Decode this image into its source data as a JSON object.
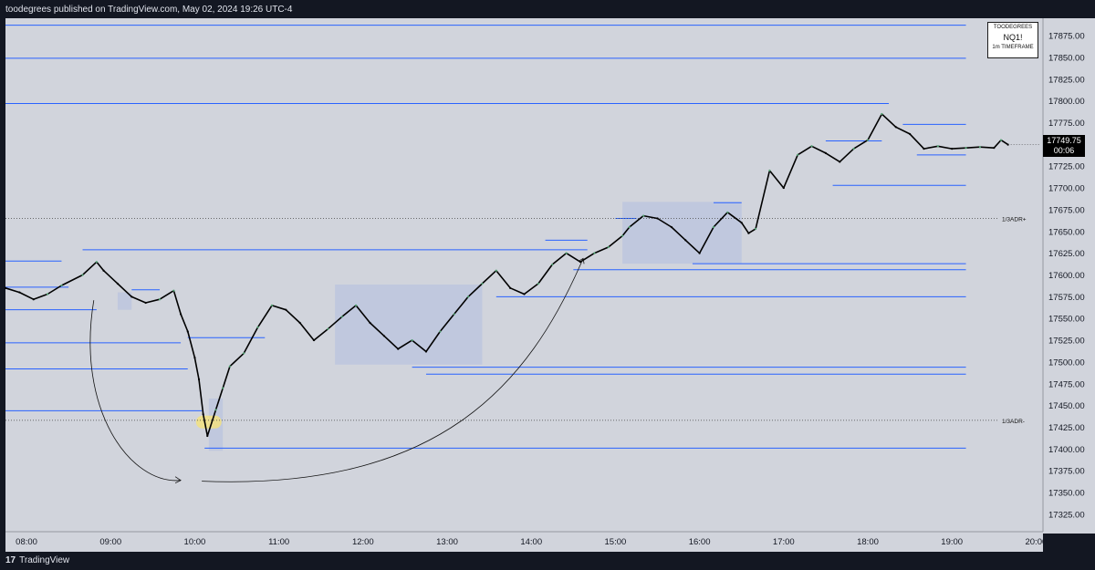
{
  "header": {
    "published": "toodegrees published on TradingView.com, May 02, 2024 19:26 UTC-4"
  },
  "footer": {
    "brand": "TradingView",
    "logo": "17"
  },
  "infobox": {
    "author": "TOODEGREES",
    "symbol": "NQ1!",
    "timeframe": "1m TIMEFRAME"
  },
  "price_tag": {
    "price": "17749.75",
    "countdown": "00:06"
  },
  "adr_labels": {
    "upper": "1/3ADR+",
    "lower": "1/3ADR-"
  },
  "colors": {
    "background": "#d1d4dc",
    "level_line": "#2962ff",
    "bull": "#50a070",
    "bear": "#000000",
    "zone": "#b2bee0",
    "highlight": "#f5e27a"
  },
  "chart_data": {
    "type": "line",
    "title": "",
    "xlabel": "",
    "ylabel": "",
    "x_ticks": [
      "08:00",
      "09:00",
      "10:00",
      "11:00",
      "12:00",
      "13:00",
      "14:00",
      "15:00",
      "16:00",
      "17:00",
      "18:00",
      "19:00",
      "20:00"
    ],
    "y_ticks": [
      17325,
      17350,
      17375,
      17400,
      17425,
      17450,
      17475,
      17500,
      17525,
      17550,
      17575,
      17600,
      17625,
      17650,
      17675,
      17700,
      17725,
      17750,
      17775,
      17800,
      17825,
      17850,
      17875
    ],
    "y_tick_labels": [
      "17325.00",
      "17350.00",
      "17375.00",
      "17400.00",
      "17425.00",
      "17450.00",
      "17475.00",
      "17500.00",
      "17525.00",
      "17550.00",
      "17575.00",
      "17600.00",
      "17625.00",
      "17650.00",
      "17675.00",
      "17700.00",
      "17725.00",
      "17750.00",
      "17775.00",
      "17800.00",
      "17825.00",
      "17850.00",
      "17875.00"
    ],
    "ylim": [
      17305,
      17895
    ],
    "xlim": [
      "07:45",
      "20:03"
    ],
    "series": [
      {
        "x": [
          "07:45",
          "07:55",
          "08:05",
          "08:15",
          "08:25",
          "08:40",
          "08:50",
          "08:55",
          "09:05",
          "09:15",
          "09:25",
          "09:35",
          "09:45",
          "09:50",
          "09:55",
          "10:00",
          "10:03",
          "10:06",
          "10:09",
          "10:15",
          "10:20",
          "10:25",
          "10:35",
          "10:45",
          "10:55",
          "11:05",
          "11:15",
          "11:25",
          "11:35",
          "11:45",
          "11:55",
          "12:05",
          "12:15",
          "12:25",
          "12:35",
          "12:45",
          "12:55",
          "13:05",
          "13:15",
          "13:25",
          "13:35",
          "13:45",
          "13:55",
          "14:05",
          "14:15",
          "14:25",
          "14:35",
          "14:45",
          "14:55",
          "15:05",
          "15:10",
          "15:20",
          "15:30",
          "15:40",
          "15:50",
          "16:00",
          "16:10",
          "16:20",
          "16:30",
          "16:35",
          "16:40",
          "16:50",
          "17:00",
          "17:10",
          "17:20",
          "17:30",
          "17:40",
          "17:50",
          "18:00",
          "18:10",
          "18:20",
          "18:30",
          "18:40",
          "18:50",
          "19:00",
          "19:10",
          "19:20",
          "19:30",
          "19:35",
          "19:40"
        ],
        "y": [
          17585,
          17580,
          17572,
          17578,
          17588,
          17600,
          17615,
          17605,
          17590,
          17575,
          17568,
          17572,
          17582,
          17555,
          17535,
          17505,
          17480,
          17440,
          17415,
          17445,
          17470,
          17495,
          17510,
          17540,
          17565,
          17560,
          17545,
          17525,
          17538,
          17552,
          17565,
          17545,
          17530,
          17515,
          17525,
          17512,
          17535,
          17555,
          17575,
          17590,
          17605,
          17585,
          17578,
          17590,
          17612,
          17625,
          17615,
          17625,
          17632,
          17645,
          17655,
          17668,
          17665,
          17655,
          17640,
          17625,
          17655,
          17672,
          17660,
          17648,
          17653,
          17720,
          17700,
          17738,
          17748,
          17740,
          17730,
          17745,
          17755,
          17785,
          17770,
          17762,
          17745,
          17748,
          17745,
          17746,
          17747,
          17746,
          17755,
          17749.75
        ]
      }
    ],
    "levels": [
      {
        "y": 17887,
        "from": "07:45",
        "to": "19:10"
      },
      {
        "y": 17849,
        "from": "07:45",
        "to": "19:10"
      },
      {
        "y": 17797,
        "from": "07:45",
        "to": "18:15"
      },
      {
        "y": 17773,
        "from": "18:25",
        "to": "19:10"
      },
      {
        "y": 17754,
        "from": "17:30",
        "to": "18:10"
      },
      {
        "y": 17738,
        "from": "18:35",
        "to": "19:10"
      },
      {
        "y": 17703,
        "from": "17:35",
        "to": "19:10"
      },
      {
        "y": 17683,
        "from": "16:10",
        "to": "16:30"
      },
      {
        "y": 17665,
        "from": "15:00",
        "to": "15:15"
      },
      {
        "y": 17640,
        "from": "14:10",
        "to": "14:40"
      },
      {
        "y": 17629,
        "from": "08:40",
        "to": "14:40"
      },
      {
        "y": 17616,
        "from": "07:45",
        "to": "08:25"
      },
      {
        "y": 17613,
        "from": "15:55",
        "to": "19:10"
      },
      {
        "y": 17606,
        "from": "14:30",
        "to": "19:10"
      },
      {
        "y": 17586,
        "from": "07:45",
        "to": "08:30"
      },
      {
        "y": 17583,
        "from": "09:15",
        "to": "09:35"
      },
      {
        "y": 17575,
        "from": "13:35",
        "to": "19:10"
      },
      {
        "y": 17560,
        "from": "07:45",
        "to": "08:50"
      },
      {
        "y": 17528,
        "from": "09:55",
        "to": "10:50"
      },
      {
        "y": 17522,
        "from": "07:45",
        "to": "09:50"
      },
      {
        "y": 17492,
        "from": "07:45",
        "to": "09:55"
      },
      {
        "y": 17494,
        "from": "12:35",
        "to": "19:10"
      },
      {
        "y": 17486,
        "from": "12:45",
        "to": "19:10"
      },
      {
        "y": 17444,
        "from": "07:45",
        "to": "10:05"
      },
      {
        "y": 17401,
        "from": "10:07",
        "to": "19:10"
      }
    ],
    "adr_levels": [
      {
        "label": "1/3ADR+",
        "y": 17665
      },
      {
        "label": "1/3ADR-",
        "y": 17433
      }
    ],
    "zones": [
      {
        "x0": "11:40",
        "x1": "13:25",
        "y0": 17497,
        "y1": 17589
      },
      {
        "x0": "15:05",
        "x1": "16:30",
        "y0": 17613,
        "y1": 17684
      },
      {
        "x0": "09:05",
        "x1": "09:15",
        "y0": 17560,
        "y1": 17580
      },
      {
        "x0": "10:10",
        "x1": "10:20",
        "y0": 17398,
        "y1": 17458
      }
    ],
    "highlight": {
      "x": "10:10",
      "y": 17431
    },
    "annotation_arrows": [
      {
        "from": {
          "x": "08:48",
          "y": 17571
        },
        "to": {
          "x": "09:50",
          "y": 17364
        }
      },
      {
        "from": {
          "x": "10:05",
          "y": 17363
        },
        "to": {
          "x": "14:37",
          "y": 17619
        }
      }
    ],
    "grid": false,
    "legend": "none"
  }
}
